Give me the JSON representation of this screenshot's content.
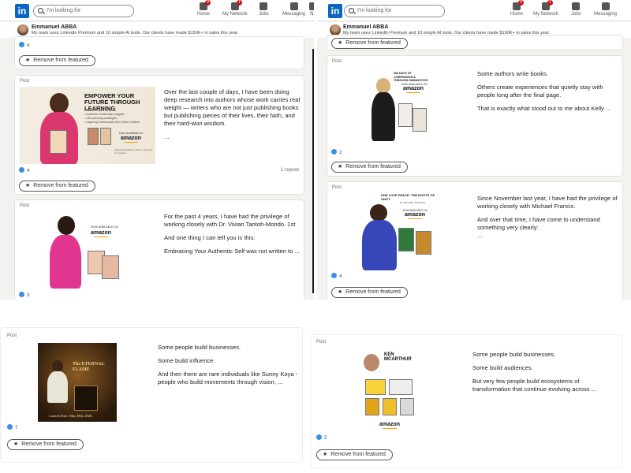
{
  "nav": {
    "logo": "in",
    "search_placeholder": "I'm looking for",
    "items": [
      {
        "label": "Home",
        "badge": "9"
      },
      {
        "label": "My Network",
        "badge": "1"
      },
      {
        "label": "Jobs",
        "badge": ""
      },
      {
        "label": "Messaging",
        "badge": ""
      },
      {
        "label": "No",
        "badge": ""
      }
    ]
  },
  "profile": {
    "name": "Emmanuel ABBA",
    "tagline": "My team uses LinkedIn Premium and 10 simple AI tools. Our clients have made $150K+ in sales this year."
  },
  "remove_label": "Remove from featured",
  "post_label": "Post",
  "panes": {
    "tl": {
      "top_reactions": "4",
      "post1": {
        "img_title": "EMPOWER YOUR FUTURE THROUGH LEARNING",
        "img_bullets": [
          "• Discover your purpose",
          "• Authentic leadership insights",
          "• Life planning strategies",
          "• Inspiring testimonials from other readers"
        ],
        "img_available": "Now available on",
        "img_amazon": "amazon",
        "img_caption": "Search the author's name / scan this on Amazon",
        "p1": "Over the last couple of days, I have been doing deep research into authors whose work carries real weight — writers who are not just publishing books but publishing pieces of their lives, their faith, and their hard-won wisdom.",
        "more": "...",
        "reactions": "4",
        "reposts": "1 repost"
      },
      "post2": {
        "img_available": "NOW AVAILABLE ON",
        "img_amazon": "amazon",
        "p1": "For the past 4 years, I have had the privilege of working closely with Dr. Vivian Tantoh-Mondo. 1st",
        "p2": "And one thing I can tell you is this:",
        "p3": "Embracing Your Authentic Self was not written to ...",
        "reactions": "3"
      }
    },
    "tr": {
      "post1": {
        "img_title": "365 DAYS OF COMPASSION & THROUGH HUMAN EYES",
        "img_available": "NOW AVAILABLE ON",
        "img_amazon": "amazon",
        "p1": "Some authors write books.",
        "p2": "Others create experiences that quietly stay with people long after the final page.",
        "p3": "That is exactly what stood out to me about Kelly ...",
        "reactions": "2"
      },
      "post2": {
        "img_title": "ONE LOVE PEACE: THE ROOTS OF UNITY",
        "img_sub": "BY MICHAEL FRANCIS",
        "img_available": "NOW AVAILABLE ON",
        "img_amazon": "amazon",
        "p1": "Since November last year, I have had the privilege of working closely with Michael Francis.",
        "p2": "And over that time, I have come to understand something very clearly:",
        "more": "...",
        "reactions": "4"
      }
    },
    "bl": {
      "img_title": "The ETERNAL FLAME",
      "img_date": "Launch Date: Mar 29th, 2026",
      "p1": "Some people build businesses.",
      "p2": "Some build influence.",
      "p3": "And then there are rare individuals like Sunny Koya - people who build movements through vision, ...",
      "reactions": "7"
    },
    "br": {
      "img_title": "KEN MCARTHUR",
      "img_amazon": "amazon",
      "p1": "Some people build businesses.",
      "p2": "Some build audiences.",
      "p3": "But very few people build ecosystems of transformation that continue evolving across ...",
      "reactions": "5"
    }
  },
  "colors": {
    "brand": "#0a66c2",
    "badge": "#cc1016",
    "reaction": "#378fe9",
    "amazon": "#ff9900"
  }
}
